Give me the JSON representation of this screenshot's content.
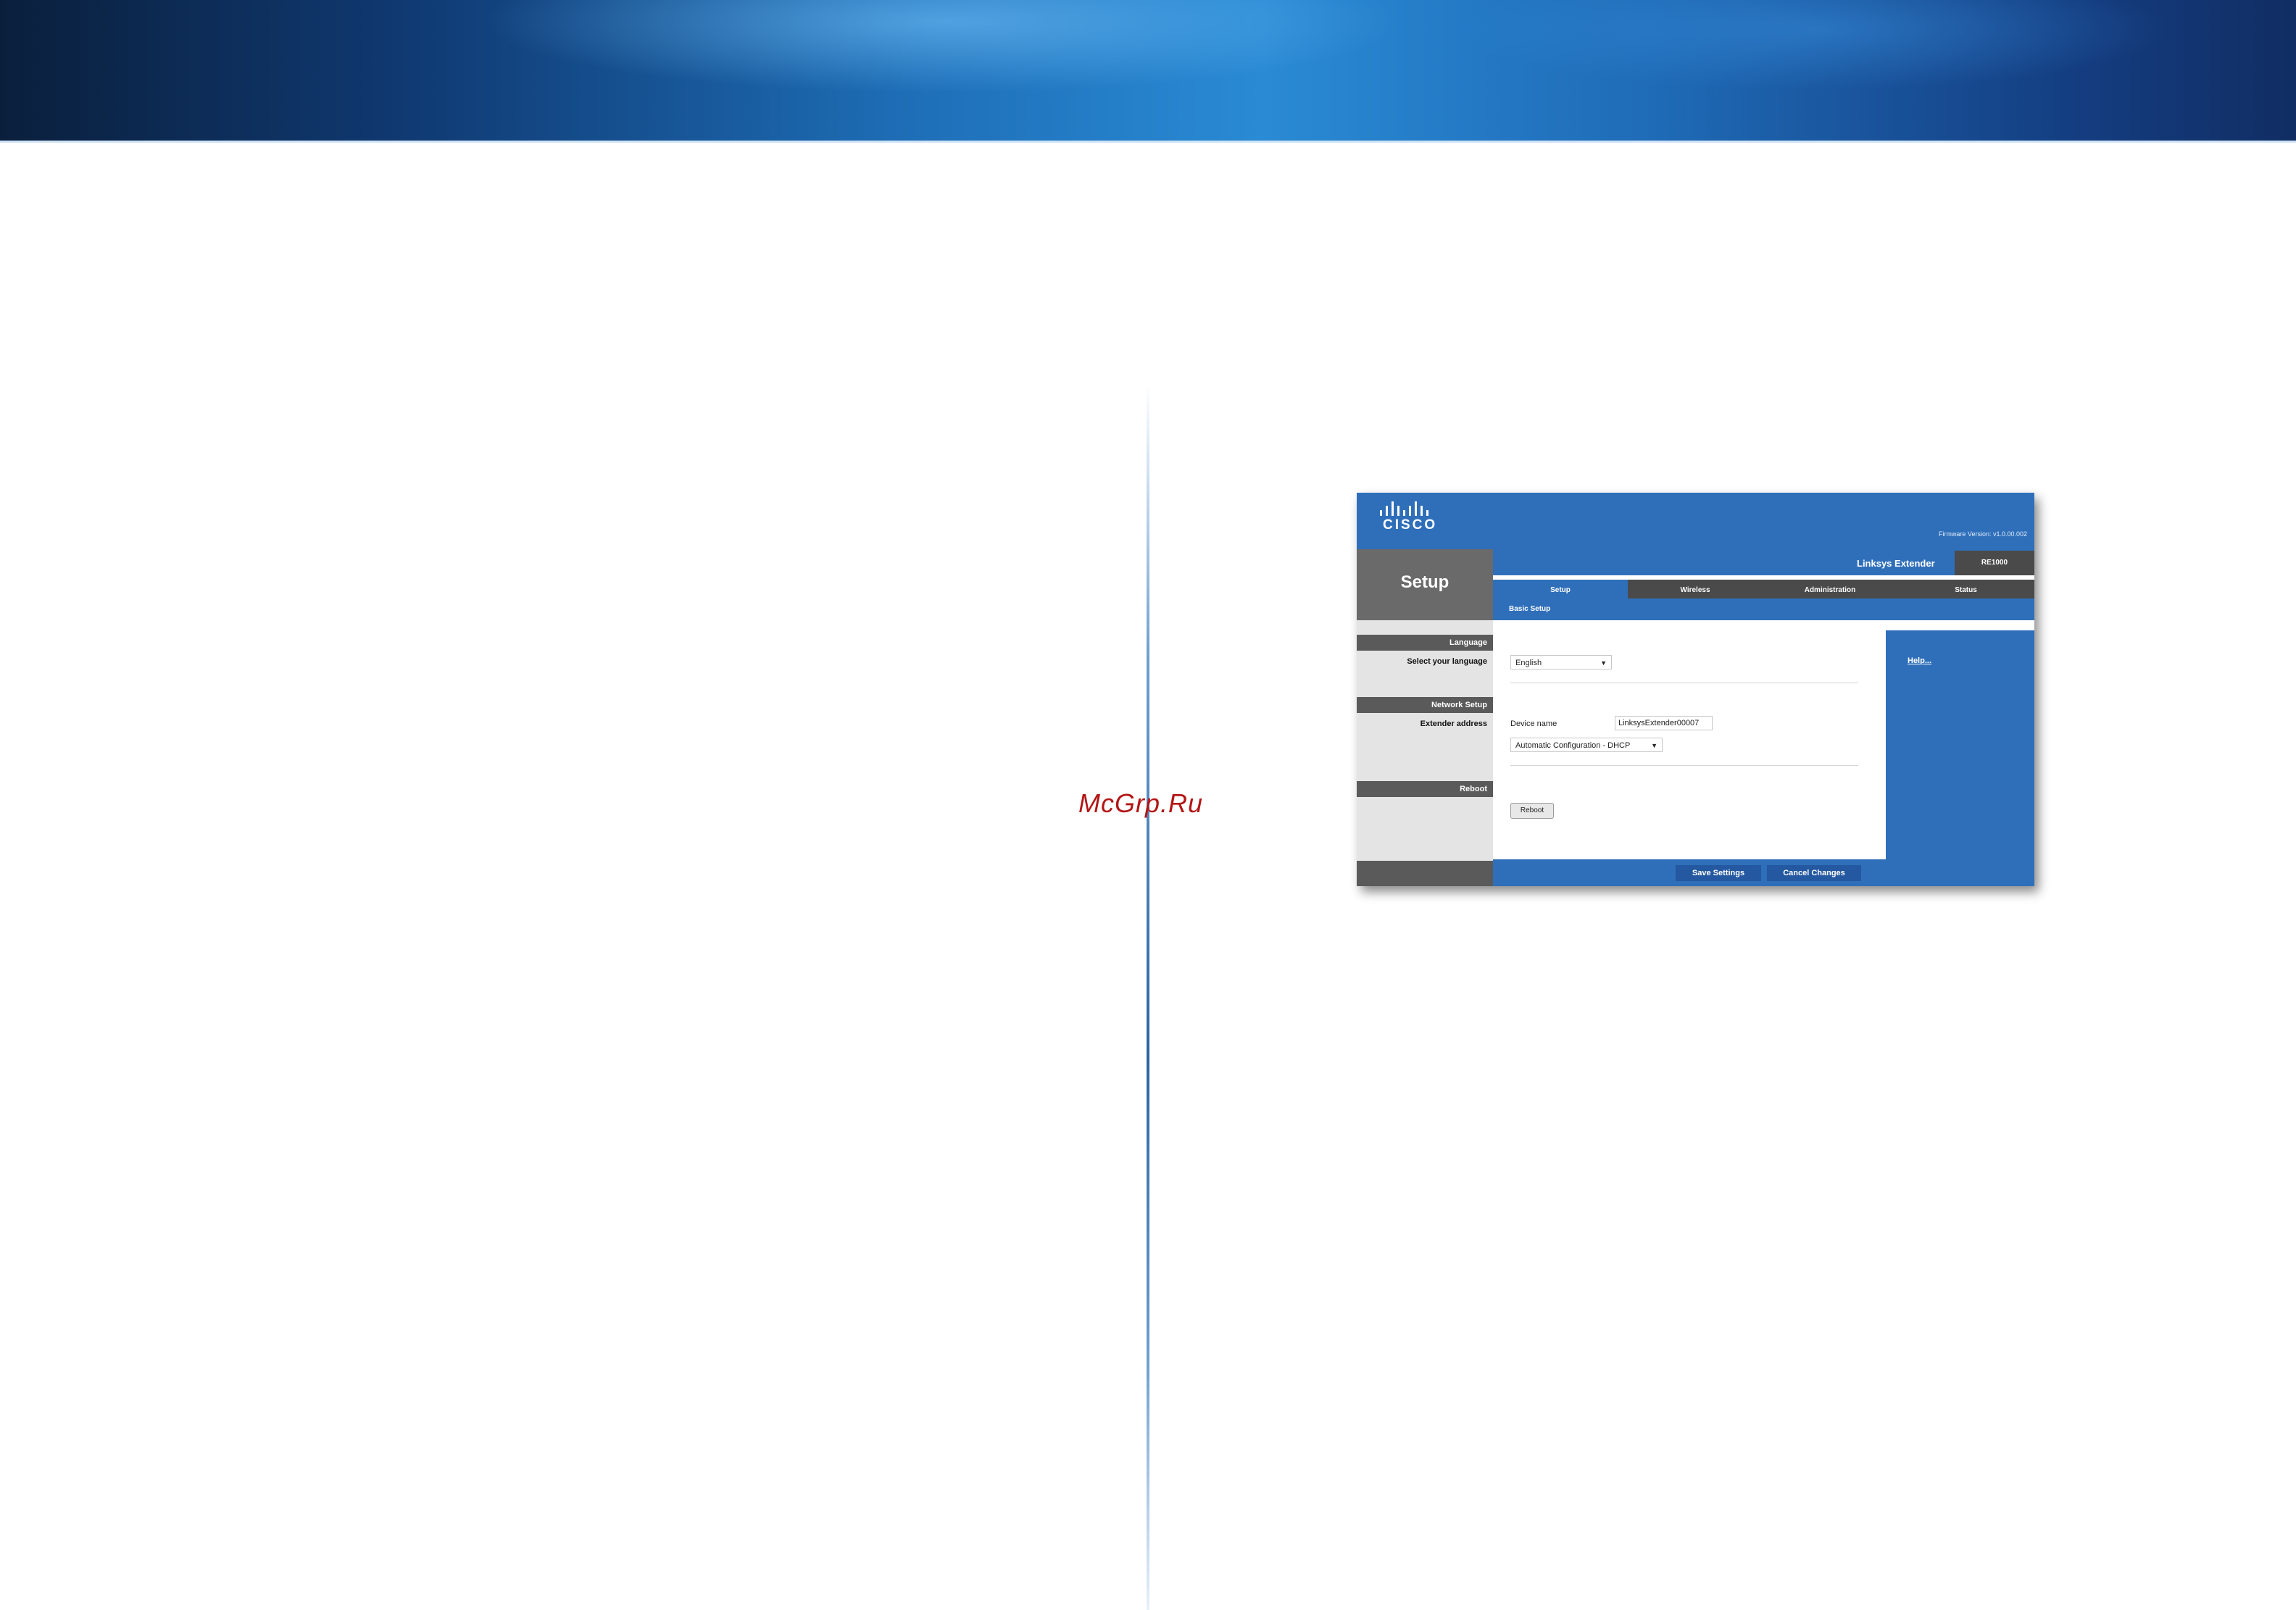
{
  "page": {
    "watermark": "McGrp.Ru"
  },
  "router_ui": {
    "logo_text": "CISCO",
    "firmware_version": "Firmware Version: v1.0.00.002",
    "product_name": "Linksys Extender",
    "reboot_label": "RE1000",
    "section_title": "Setup",
    "tabs": [
      {
        "label": "Setup",
        "active": true
      },
      {
        "label": "Wireless",
        "active": false
      },
      {
        "label": "Administration",
        "active": false
      },
      {
        "label": "Status",
        "active": false
      }
    ],
    "subtab": "Basic Setup",
    "sidebar": {
      "language_head": "Language",
      "language_label": "Select your language",
      "network_head": "Network Setup",
      "network_label": "Extender address",
      "reboot_head": "Reboot"
    },
    "language_value": "English",
    "device_name_label": "Device name",
    "device_name_value": "LinksysExtender00007",
    "address_mode_value": "Automatic Configuration - DHCP",
    "reboot_button": "Reboot",
    "help_link": "Help...",
    "save_button": "Save Settings",
    "cancel_button": "Cancel Changes"
  }
}
